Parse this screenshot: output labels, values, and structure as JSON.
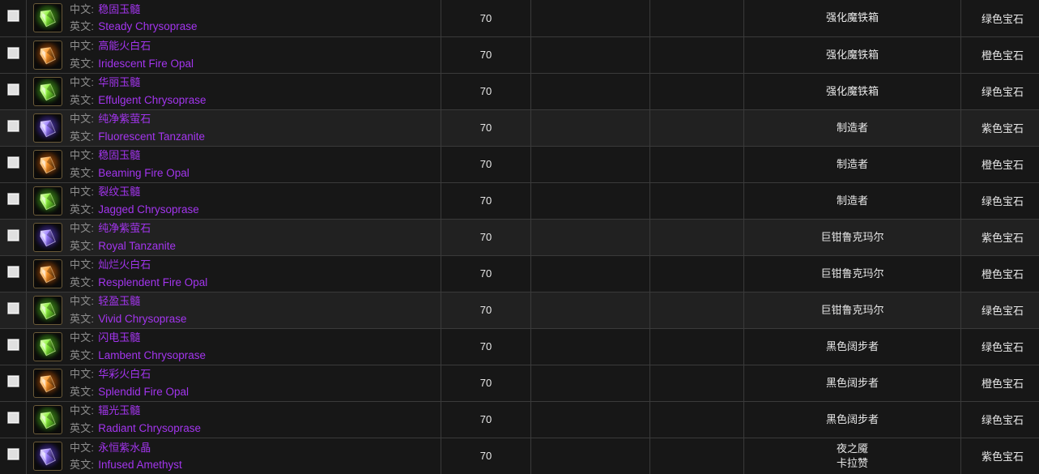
{
  "labels": {
    "zh": "中文:",
    "en": "英文:"
  },
  "rows": [
    {
      "checked": false,
      "icon": "gem-green-chrysoprase-icon",
      "gem": "green",
      "name_zh": "稳固玉髓",
      "name_en": "Steady Chrysoprase",
      "level": "70",
      "blank1": "",
      "blank2": "",
      "source": [
        "强化魔铁箱"
      ],
      "color": "绿色宝石",
      "alt": false
    },
    {
      "checked": false,
      "icon": "gem-orange-fire-opal-icon",
      "gem": "orange",
      "name_zh": "高能火白石",
      "name_en": "Iridescent Fire Opal",
      "level": "70",
      "blank1": "",
      "blank2": "",
      "source": [
        "强化魔铁箱"
      ],
      "color": "橙色宝石",
      "alt": false
    },
    {
      "checked": false,
      "icon": "gem-green-chrysoprase-icon",
      "gem": "green",
      "name_zh": "华丽玉髓",
      "name_en": "Effulgent Chrysoprase",
      "level": "70",
      "blank1": "",
      "blank2": "",
      "source": [
        "强化魔铁箱"
      ],
      "color": "绿色宝石",
      "alt": false
    },
    {
      "checked": false,
      "icon": "gem-purple-tanzanite-icon",
      "gem": "purple",
      "name_zh": "纯净紫萤石",
      "name_en": "Fluorescent Tanzanite",
      "level": "70",
      "blank1": "",
      "blank2": "",
      "source": [
        "制造者"
      ],
      "color": "紫色宝石",
      "alt": true
    },
    {
      "checked": false,
      "icon": "gem-orange-fire-opal-icon",
      "gem": "orange",
      "name_zh": "稳固玉髓",
      "name_en": "Beaming Fire Opal",
      "level": "70",
      "blank1": "",
      "blank2": "",
      "source": [
        "制造者"
      ],
      "color": "橙色宝石",
      "alt": false
    },
    {
      "checked": false,
      "icon": "gem-green-chrysoprase-icon",
      "gem": "green",
      "name_zh": "裂纹玉髓",
      "name_en": "Jagged Chrysoprase",
      "level": "70",
      "blank1": "",
      "blank2": "",
      "source": [
        "制造者"
      ],
      "color": "绿色宝石",
      "alt": false
    },
    {
      "checked": false,
      "icon": "gem-purple-tanzanite-icon",
      "gem": "purple",
      "name_zh": "纯净紫萤石",
      "name_en": "Royal Tanzanite",
      "level": "70",
      "blank1": "",
      "blank2": "",
      "source": [
        "巨钳鲁克玛尔"
      ],
      "color": "紫色宝石",
      "alt": true
    },
    {
      "checked": false,
      "icon": "gem-orange-fire-opal-icon",
      "gem": "orange",
      "name_zh": "灿烂火白石",
      "name_en": "Resplendent Fire Opal",
      "level": "70",
      "blank1": "",
      "blank2": "",
      "source": [
        "巨钳鲁克玛尔"
      ],
      "color": "橙色宝石",
      "alt": false
    },
    {
      "checked": false,
      "icon": "gem-green-chrysoprase-icon",
      "gem": "green",
      "name_zh": "轻盈玉髓",
      "name_en": "Vivid Chrysoprase",
      "level": "70",
      "blank1": "",
      "blank2": "",
      "source": [
        "巨钳鲁克玛尔"
      ],
      "color": "绿色宝石",
      "alt": true
    },
    {
      "checked": false,
      "icon": "gem-green-chrysoprase-icon",
      "gem": "green",
      "name_zh": "闪电玉髓",
      "name_en": "Lambent Chrysoprase",
      "level": "70",
      "blank1": "",
      "blank2": "",
      "source": [
        "黑色阔步者"
      ],
      "color": "绿色宝石",
      "alt": false
    },
    {
      "checked": false,
      "icon": "gem-orange-fire-opal-icon",
      "gem": "orange",
      "name_zh": "华彩火白石",
      "name_en": "Splendid Fire Opal",
      "level": "70",
      "blank1": "",
      "blank2": "",
      "source": [
        "黑色阔步者"
      ],
      "color": "橙色宝石",
      "alt": false
    },
    {
      "checked": false,
      "icon": "gem-green-chrysoprase-icon",
      "gem": "green",
      "name_zh": "辐光玉髓",
      "name_en": "Radiant Chrysoprase",
      "level": "70",
      "blank1": "",
      "blank2": "",
      "source": [
        "黑色阔步者"
      ],
      "color": "绿色宝石",
      "alt": false
    },
    {
      "checked": false,
      "icon": "gem-purple-amethyst-icon",
      "gem": "purple",
      "name_zh": "永恒紫水晶",
      "name_en": "Infused Amethyst",
      "level": "70",
      "blank1": "",
      "blank2": "",
      "source": [
        "夜之魇",
        "卡拉赞"
      ],
      "color": "紫色宝石",
      "alt": false
    }
  ],
  "theme": {
    "epic_text": "#a335ee",
    "label_text": "#8d8d8d",
    "row_bg": "#171717",
    "row_bg_alt": "#212121",
    "border": "#3a3a3a",
    "gem_green": "#7fe03a",
    "gem_orange": "#ff9127",
    "gem_purple": "#9a7dff"
  }
}
